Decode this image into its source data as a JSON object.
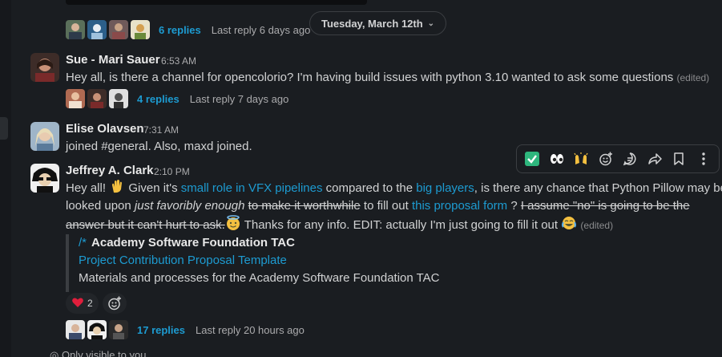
{
  "date_divider": {
    "label": "Tuesday, March 12th"
  },
  "thread0": {
    "replies": "6 replies",
    "last_reply": "Last reply 6 days ago"
  },
  "messages": [
    {
      "author": "Sue - Mari Sauer",
      "time": "6:53 AM",
      "text": "Hey all, is there a channel for opencolorio? I'm having build issues with python 3.10 wanted to ask some questions",
      "edited": "(edited)",
      "replies": "4 replies",
      "last_reply": "Last reply 7 days ago"
    },
    {
      "author": "Elise Olavsen",
      "time": "7:31 AM",
      "text": "joined #general. Also, maxd joined."
    },
    {
      "author": "Jeffrey A. Clark",
      "time": "2:10 PM",
      "t1": "Hey all! ",
      "t2": " Given it's ",
      "link1": "small role in VFX pipelines",
      "t3": " compared to the ",
      "link2": "big players",
      "t4": ", is there any chance that Python Pillow may be",
      "t5": "looked upon ",
      "italic": "just favoribly enough",
      "t6": " ",
      "strike1": "to make it worthwhile",
      "t7": " to fill out ",
      "link3": "this proposal form",
      "t8": " ? ",
      "strike2": "I assume \"no\" is going to be the",
      "strike3": "answer but it can't hurt to ask.",
      "t9": " Thanks for any info. EDIT: actually I'm just going to fill it out ",
      "edited": "(edited)",
      "attachment": {
        "source": "Academy Software Foundation TAC",
        "title": "Project Contribution Proposal Template",
        "description": "Materials and processes for the Academy Software Foundation TAC"
      },
      "reaction_count": "2",
      "replies": "17 replies",
      "last_reply": "Last reply 20 hours ago"
    }
  ],
  "footer": {
    "text": "Only visible to you"
  },
  "colors": {
    "background": "#1a1d21",
    "link": "#1d9bd1",
    "text": "#d1d2d3",
    "border": "#3b3e42"
  },
  "icons": [
    "white-check-mark-icon",
    "eyes-icon",
    "raised-hands-icon",
    "add-reaction-icon",
    "reply-in-thread-icon",
    "share-icon",
    "bookmark-icon",
    "more-actions-icon"
  ]
}
